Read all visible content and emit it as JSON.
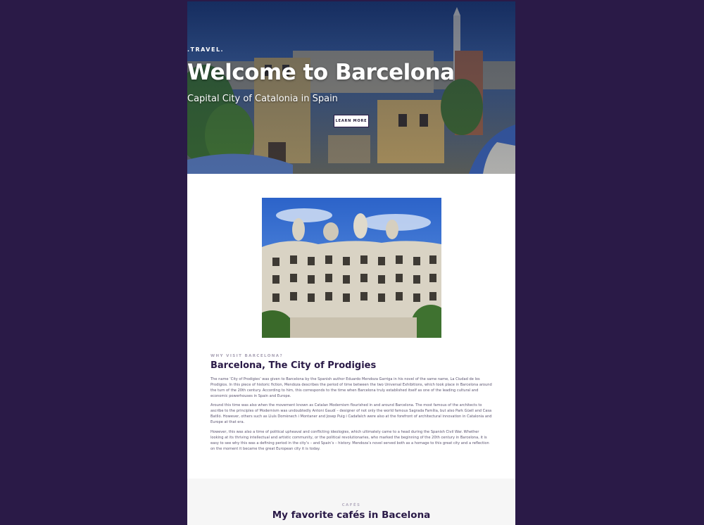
{
  "hero": {
    "eyebrow": ".TRAVEL.",
    "title": "Welcome to Barcelona",
    "subtitle": "Capital City of Catalonia in Spain",
    "button_label": "LEARN MORE"
  },
  "article": {
    "kicker": "WHY VISIT BARCELONA?",
    "title": "Barcelona, The City of Prodigies",
    "paragraphs": [
      "The name ‘City of Prodigies’ was given to Barcelona by the Spanish author Eduardo Mendoza Garriga in his novel of the same name, La Ciudad de los Prodigios. In this piece of historic fiction, Mendoza describes the period of time between the two Universal Exhibitions, which took place in Barcelona around the turn of the 20th century. According to him, this corresponds to the time when Barcelona truly established itself as one of the leading cultural and economic powerhouses in Spain and Europe.",
      "Around this time was also when the movement known as Catalan Modernism flourished in and around Barcelona. The most famous of the architects to ascribe to the principles of Modernism was undoubtedly Antoni Gaudí – designer of not only the world famous Sagrada Família, but also Park Güell and Casa Batlló. However, others such as Lluís Domènech i Montaner and Josep Puig i Cadafalch were also at the forefront of architectural innovation in Catalonia and Europe at that era.",
      "However, this was also a time of political upheaval and conflicting ideologies, which ultimately came to a head during the Spanish Civil War. Whether looking at its thriving intellectual and artistic community, or the political revolutionaries, who marked the beginning of the 20th century in Barcelona, it is easy to see why this was a defining period in the city’s – and Spain’s – history. Mendoza’s novel served both as a homage to this great city and a reflection on the moment it became the great European city it is today."
    ]
  },
  "cafes": {
    "kicker": "CAFÉS",
    "title": "My favorite cafés in Bacelona"
  },
  "colors": {
    "background": "#2a1a47",
    "heading": "#2a1a47",
    "body_text": "#5b5470",
    "kicker": "#a8a1b4",
    "section_bg": "#f6f6f6"
  }
}
